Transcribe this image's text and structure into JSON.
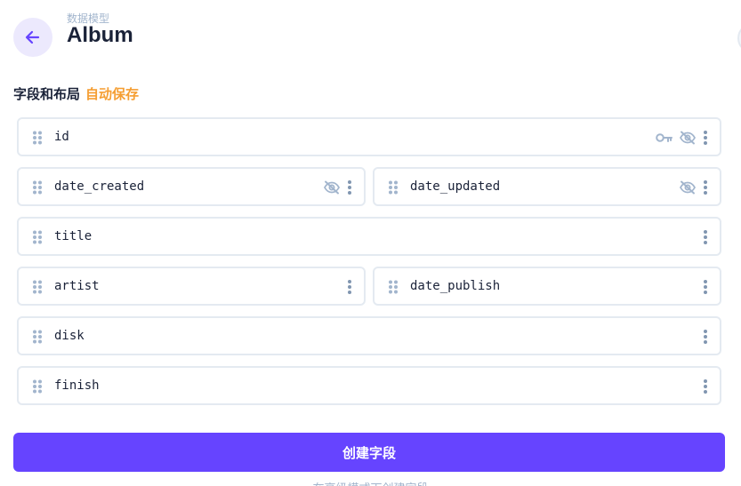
{
  "header": {
    "breadcrumb": "数据模型",
    "title": "Album",
    "back_icon": "arrow-left-icon"
  },
  "section": {
    "title": "字段和布局",
    "autosave_label": "自动保存"
  },
  "fields": [
    {
      "name": "id",
      "width": "full",
      "icons": [
        "key-icon",
        "eye-off-icon",
        "more-vertical-icon"
      ]
    },
    {
      "name": "date_created",
      "width": "half",
      "icons": [
        "eye-off-icon",
        "more-vertical-icon"
      ]
    },
    {
      "name": "date_updated",
      "width": "half",
      "icons": [
        "eye-off-icon",
        "more-vertical-icon"
      ]
    },
    {
      "name": "title",
      "width": "full",
      "icons": [
        "more-vertical-icon"
      ]
    },
    {
      "name": "artist",
      "width": "half",
      "icons": [
        "more-vertical-icon"
      ]
    },
    {
      "name": "date_publish",
      "width": "half",
      "icons": [
        "more-vertical-icon"
      ]
    },
    {
      "name": "disk",
      "width": "full",
      "icons": [
        "more-vertical-icon"
      ]
    },
    {
      "name": "finish",
      "width": "full",
      "icons": [
        "more-vertical-icon"
      ]
    }
  ],
  "actions": {
    "create_field_label": "创建字段",
    "advanced_mode_label": "在高级模式下创建字段"
  },
  "colors": {
    "accent": "#6644ff",
    "autosave": "#f59e32",
    "border": "#e4eaf1",
    "icon": "#a2b5cd"
  }
}
